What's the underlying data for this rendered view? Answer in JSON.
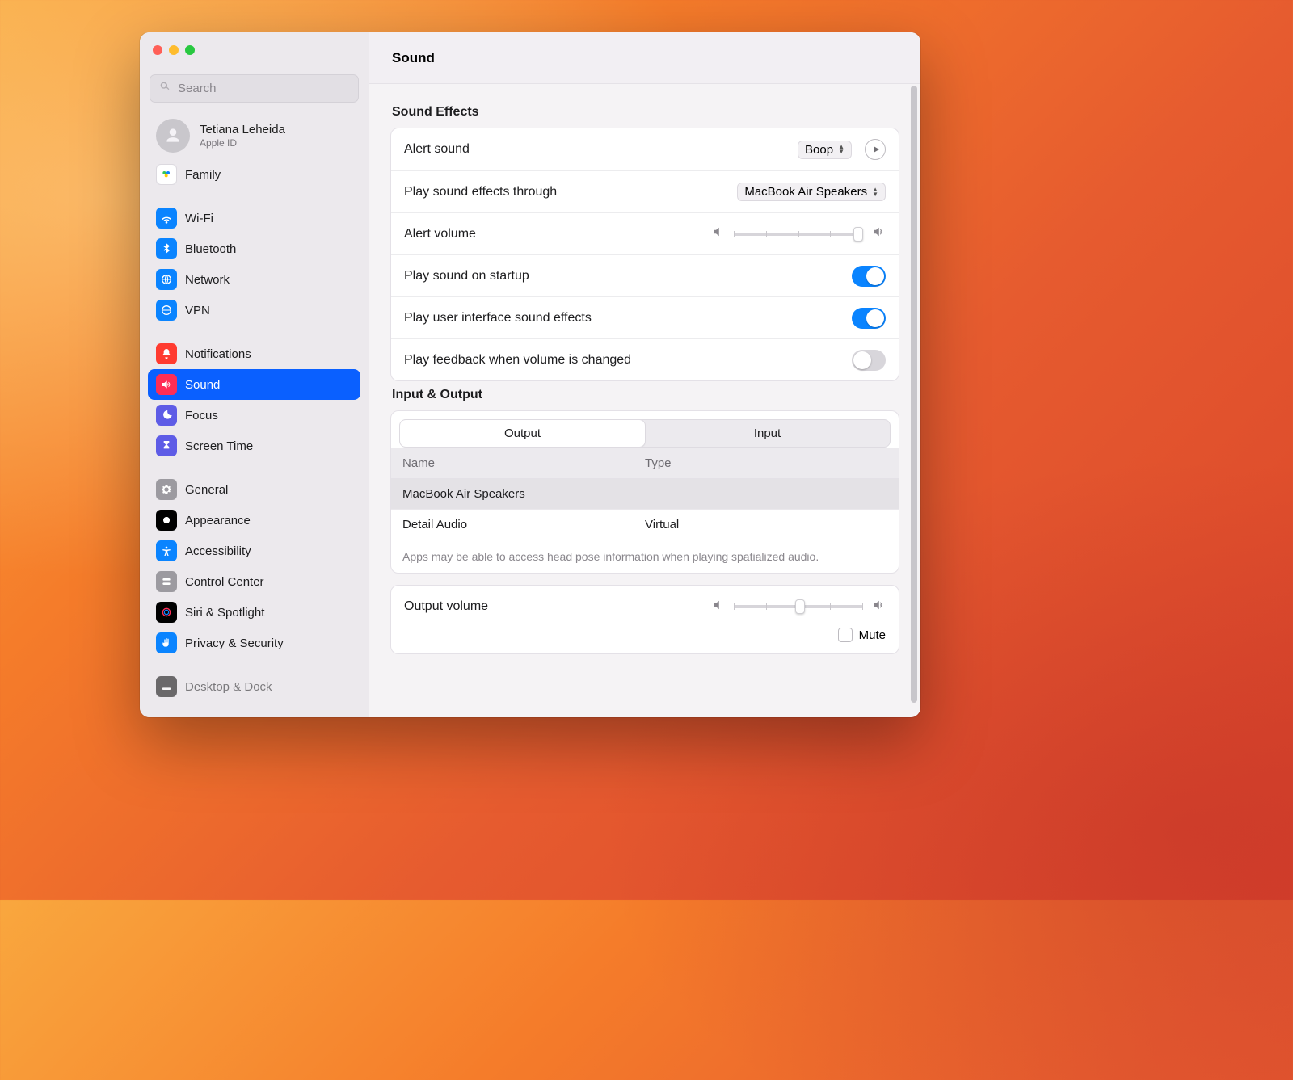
{
  "header": {
    "title": "Sound"
  },
  "search": {
    "placeholder": "Search"
  },
  "account": {
    "name": "Tetiana Leheida",
    "sub": "Apple ID"
  },
  "sidebar": {
    "family": "Family",
    "items": [
      "Wi-Fi",
      "Bluetooth",
      "Network",
      "VPN",
      "Notifications",
      "Sound",
      "Focus",
      "Screen Time",
      "General",
      "Appearance",
      "Accessibility",
      "Control Center",
      "Siri & Spotlight",
      "Privacy & Security",
      "Desktop & Dock"
    ]
  },
  "effects": {
    "title": "Sound Effects",
    "alert_sound_label": "Alert sound",
    "alert_sound_value": "Boop",
    "play_through_label": "Play sound effects through",
    "play_through_value": "MacBook Air Speakers",
    "alert_volume_label": "Alert volume",
    "startup_label": "Play sound on startup",
    "ui_sounds_label": "Play user interface sound effects",
    "feedback_label": "Play feedback when volume is changed"
  },
  "io": {
    "title": "Input & Output",
    "tabs": {
      "output": "Output",
      "input": "Input"
    },
    "columns": {
      "name": "Name",
      "type": "Type"
    },
    "rows": [
      {
        "name": "MacBook Air Speakers",
        "type": ""
      },
      {
        "name": "Detail Audio",
        "type": "Virtual"
      }
    ],
    "note": "Apps may be able to access head pose information when playing spatialized audio."
  },
  "output": {
    "volume_label": "Output volume",
    "mute_label": "Mute"
  }
}
